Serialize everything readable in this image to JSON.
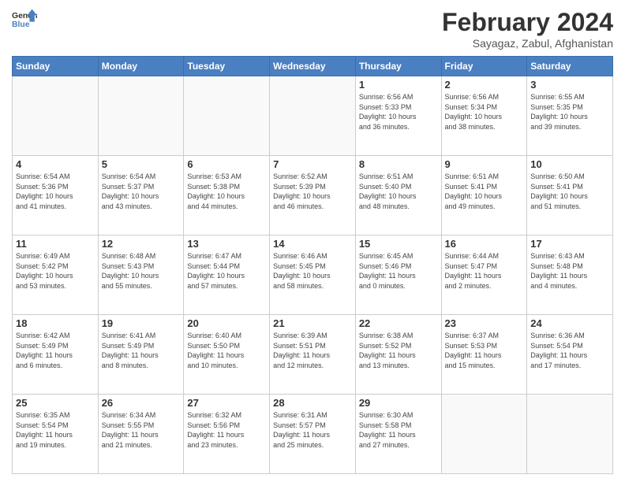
{
  "logo": {
    "text_general": "General",
    "text_blue": "Blue"
  },
  "title": "February 2024",
  "subtitle": "Sayagaz, Zabul, Afghanistan",
  "days_header": [
    "Sunday",
    "Monday",
    "Tuesday",
    "Wednesday",
    "Thursday",
    "Friday",
    "Saturday"
  ],
  "weeks": [
    [
      {
        "day": "",
        "info": ""
      },
      {
        "day": "",
        "info": ""
      },
      {
        "day": "",
        "info": ""
      },
      {
        "day": "",
        "info": ""
      },
      {
        "day": "1",
        "info": "Sunrise: 6:56 AM\nSunset: 5:33 PM\nDaylight: 10 hours\nand 36 minutes."
      },
      {
        "day": "2",
        "info": "Sunrise: 6:56 AM\nSunset: 5:34 PM\nDaylight: 10 hours\nand 38 minutes."
      },
      {
        "day": "3",
        "info": "Sunrise: 6:55 AM\nSunset: 5:35 PM\nDaylight: 10 hours\nand 39 minutes."
      }
    ],
    [
      {
        "day": "4",
        "info": "Sunrise: 6:54 AM\nSunset: 5:36 PM\nDaylight: 10 hours\nand 41 minutes."
      },
      {
        "day": "5",
        "info": "Sunrise: 6:54 AM\nSunset: 5:37 PM\nDaylight: 10 hours\nand 43 minutes."
      },
      {
        "day": "6",
        "info": "Sunrise: 6:53 AM\nSunset: 5:38 PM\nDaylight: 10 hours\nand 44 minutes."
      },
      {
        "day": "7",
        "info": "Sunrise: 6:52 AM\nSunset: 5:39 PM\nDaylight: 10 hours\nand 46 minutes."
      },
      {
        "day": "8",
        "info": "Sunrise: 6:51 AM\nSunset: 5:40 PM\nDaylight: 10 hours\nand 48 minutes."
      },
      {
        "day": "9",
        "info": "Sunrise: 6:51 AM\nSunset: 5:41 PM\nDaylight: 10 hours\nand 49 minutes."
      },
      {
        "day": "10",
        "info": "Sunrise: 6:50 AM\nSunset: 5:41 PM\nDaylight: 10 hours\nand 51 minutes."
      }
    ],
    [
      {
        "day": "11",
        "info": "Sunrise: 6:49 AM\nSunset: 5:42 PM\nDaylight: 10 hours\nand 53 minutes."
      },
      {
        "day": "12",
        "info": "Sunrise: 6:48 AM\nSunset: 5:43 PM\nDaylight: 10 hours\nand 55 minutes."
      },
      {
        "day": "13",
        "info": "Sunrise: 6:47 AM\nSunset: 5:44 PM\nDaylight: 10 hours\nand 57 minutes."
      },
      {
        "day": "14",
        "info": "Sunrise: 6:46 AM\nSunset: 5:45 PM\nDaylight: 10 hours\nand 58 minutes."
      },
      {
        "day": "15",
        "info": "Sunrise: 6:45 AM\nSunset: 5:46 PM\nDaylight: 11 hours\nand 0 minutes."
      },
      {
        "day": "16",
        "info": "Sunrise: 6:44 AM\nSunset: 5:47 PM\nDaylight: 11 hours\nand 2 minutes."
      },
      {
        "day": "17",
        "info": "Sunrise: 6:43 AM\nSunset: 5:48 PM\nDaylight: 11 hours\nand 4 minutes."
      }
    ],
    [
      {
        "day": "18",
        "info": "Sunrise: 6:42 AM\nSunset: 5:49 PM\nDaylight: 11 hours\nand 6 minutes."
      },
      {
        "day": "19",
        "info": "Sunrise: 6:41 AM\nSunset: 5:49 PM\nDaylight: 11 hours\nand 8 minutes."
      },
      {
        "day": "20",
        "info": "Sunrise: 6:40 AM\nSunset: 5:50 PM\nDaylight: 11 hours\nand 10 minutes."
      },
      {
        "day": "21",
        "info": "Sunrise: 6:39 AM\nSunset: 5:51 PM\nDaylight: 11 hours\nand 12 minutes."
      },
      {
        "day": "22",
        "info": "Sunrise: 6:38 AM\nSunset: 5:52 PM\nDaylight: 11 hours\nand 13 minutes."
      },
      {
        "day": "23",
        "info": "Sunrise: 6:37 AM\nSunset: 5:53 PM\nDaylight: 11 hours\nand 15 minutes."
      },
      {
        "day": "24",
        "info": "Sunrise: 6:36 AM\nSunset: 5:54 PM\nDaylight: 11 hours\nand 17 minutes."
      }
    ],
    [
      {
        "day": "25",
        "info": "Sunrise: 6:35 AM\nSunset: 5:54 PM\nDaylight: 11 hours\nand 19 minutes."
      },
      {
        "day": "26",
        "info": "Sunrise: 6:34 AM\nSunset: 5:55 PM\nDaylight: 11 hours\nand 21 minutes."
      },
      {
        "day": "27",
        "info": "Sunrise: 6:32 AM\nSunset: 5:56 PM\nDaylight: 11 hours\nand 23 minutes."
      },
      {
        "day": "28",
        "info": "Sunrise: 6:31 AM\nSunset: 5:57 PM\nDaylight: 11 hours\nand 25 minutes."
      },
      {
        "day": "29",
        "info": "Sunrise: 6:30 AM\nSunset: 5:58 PM\nDaylight: 11 hours\nand 27 minutes."
      },
      {
        "day": "",
        "info": ""
      },
      {
        "day": "",
        "info": ""
      }
    ]
  ]
}
